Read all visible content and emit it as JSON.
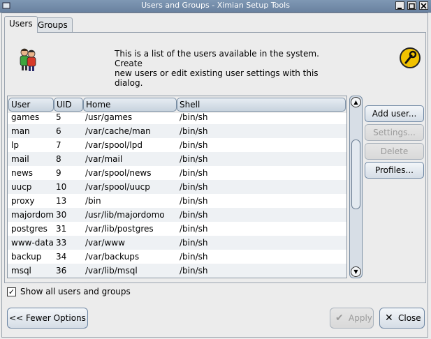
{
  "window": {
    "title": "Users and Groups - Ximian Setup Tools"
  },
  "tabs": [
    {
      "label": "Users",
      "active": true
    },
    {
      "label": "Groups",
      "active": false
    }
  ],
  "description": {
    "line1": "This is a list of the users available in the system. Create",
    "line2": "new users or edit existing user settings with this dialog."
  },
  "table": {
    "columns": [
      "User",
      "UID",
      "Home",
      "Shell"
    ],
    "rows": [
      {
        "user": "games",
        "uid": "5",
        "home": "/usr/games",
        "shell": "/bin/sh"
      },
      {
        "user": "man",
        "uid": "6",
        "home": "/var/cache/man",
        "shell": "/bin/sh"
      },
      {
        "user": "lp",
        "uid": "7",
        "home": "/var/spool/lpd",
        "shell": "/bin/sh"
      },
      {
        "user": "mail",
        "uid": "8",
        "home": "/var/mail",
        "shell": "/bin/sh"
      },
      {
        "user": "news",
        "uid": "9",
        "home": "/var/spool/news",
        "shell": "/bin/sh"
      },
      {
        "user": "uucp",
        "uid": "10",
        "home": "/var/spool/uucp",
        "shell": "/bin/sh"
      },
      {
        "user": "proxy",
        "uid": "13",
        "home": "/bin",
        "shell": "/bin/sh"
      },
      {
        "user": "majordom",
        "uid": "30",
        "home": "/usr/lib/majordomo",
        "shell": "/bin/sh"
      },
      {
        "user": "postgres",
        "uid": "31",
        "home": "/var/lib/postgres",
        "shell": "/bin/sh"
      },
      {
        "user": "www-data",
        "uid": "33",
        "home": "/var/www",
        "shell": "/bin/sh"
      },
      {
        "user": "backup",
        "uid": "34",
        "home": "/var/backups",
        "shell": "/bin/sh"
      },
      {
        "user": "msql",
        "uid": "36",
        "home": "/var/lib/msql",
        "shell": "/bin/sh"
      }
    ]
  },
  "side_buttons": {
    "add": {
      "label": "Add user...",
      "enabled": true
    },
    "settings": {
      "label": "Settings...",
      "enabled": false
    },
    "delete": {
      "label": "Delete",
      "enabled": false
    },
    "profiles": {
      "label": "Profiles...",
      "enabled": true
    }
  },
  "show_all": {
    "label": "Show all users and groups",
    "checked": true
  },
  "bottom_buttons": {
    "fewer": "<< Fewer Options",
    "apply": "Apply",
    "close": "Close"
  },
  "icons": {
    "users": "users-icon",
    "help": "help-wrench-icon",
    "apply": "checkmark-icon",
    "close": "close-x-icon"
  },
  "colors": {
    "title_bar": "#6a82a0",
    "help_badge": "#f2c200"
  }
}
